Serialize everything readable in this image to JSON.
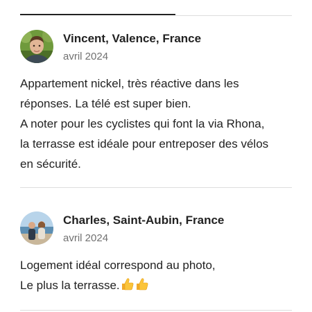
{
  "reviews": [
    {
      "name": "Vincent, Valence, France",
      "date": "avril 2024",
      "lines": [
        "Appartement nickel, très réactive dans les",
        "réponses. La télé est super bien.",
        "A noter pour les cyclistes qui font la via Rhona,",
        "la terrasse est idéale pour entreposer des vélos",
        "en sécurité."
      ]
    },
    {
      "name": "Charles, Saint-Aubin, France",
      "date": "avril 2024",
      "lines": [
        "Logement idéal correspond au photo,",
        "Le plus la terrasse."
      ],
      "emoji": [
        "thumbs-up-icon",
        "thumbs-up-icon"
      ]
    }
  ]
}
